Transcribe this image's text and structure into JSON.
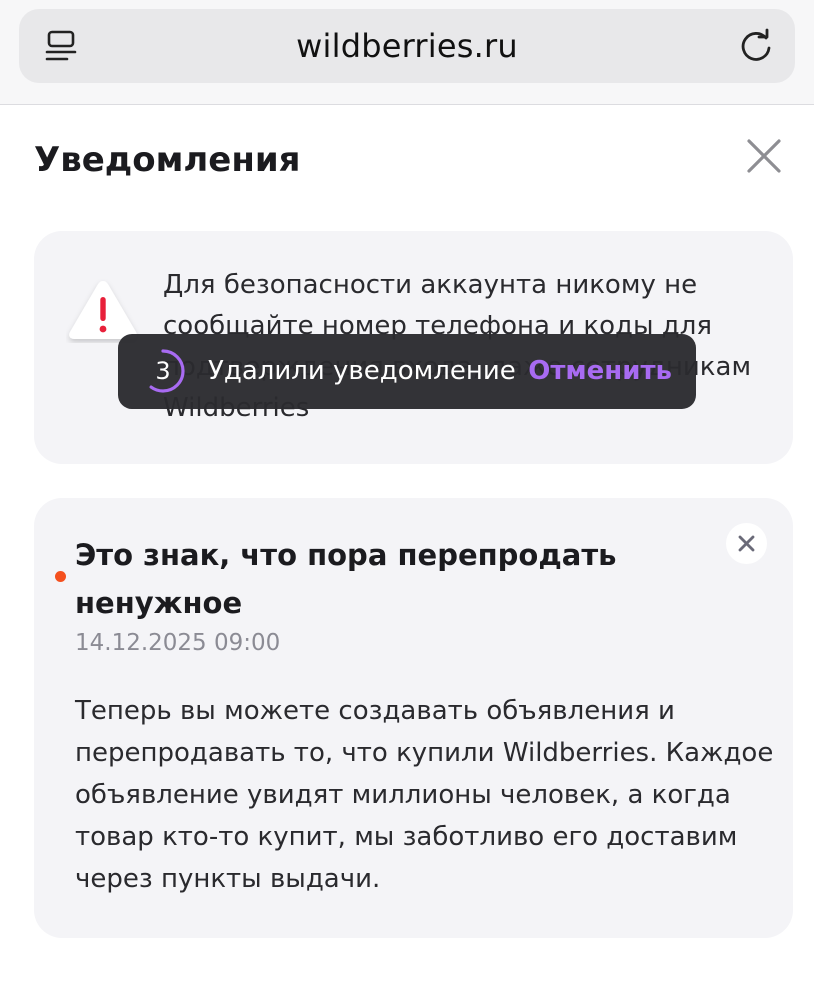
{
  "browser": {
    "url": "wildberries.ru",
    "icons": {
      "reader": "reader-mode-icon",
      "reload": "reload-icon"
    }
  },
  "page": {
    "title": "Уведомления",
    "close_icon": "close-icon"
  },
  "warning_card": {
    "icon": "warning-triangle-icon",
    "text": "Для безопасности аккаунта никому не сообщайте номер телефона и коды для подтверждения входа, даже сотрудникам Wildberries"
  },
  "notification": {
    "title": "Это знак, что пора перепродать ненужное",
    "date": "14.12.2025 09:00",
    "body": "Теперь вы можете создавать объявления и перепродавать то, что купили Wildberries. Каждое объявление увидят миллионы человек, а когда товар кто-то купит, мы заботливо его доставим через пункты выдачи.",
    "unread": true,
    "dismiss_icon": "close-icon"
  },
  "toast": {
    "countdown": "3",
    "countdown_progress": 0.6,
    "message": "Удалили уведомление",
    "action_label": "Отменить"
  },
  "colors": {
    "accent": "#a86bf2",
    "unread_dot": "#f4501e",
    "card_bg": "#f4f4f7",
    "warning_red": "#e8203a"
  }
}
